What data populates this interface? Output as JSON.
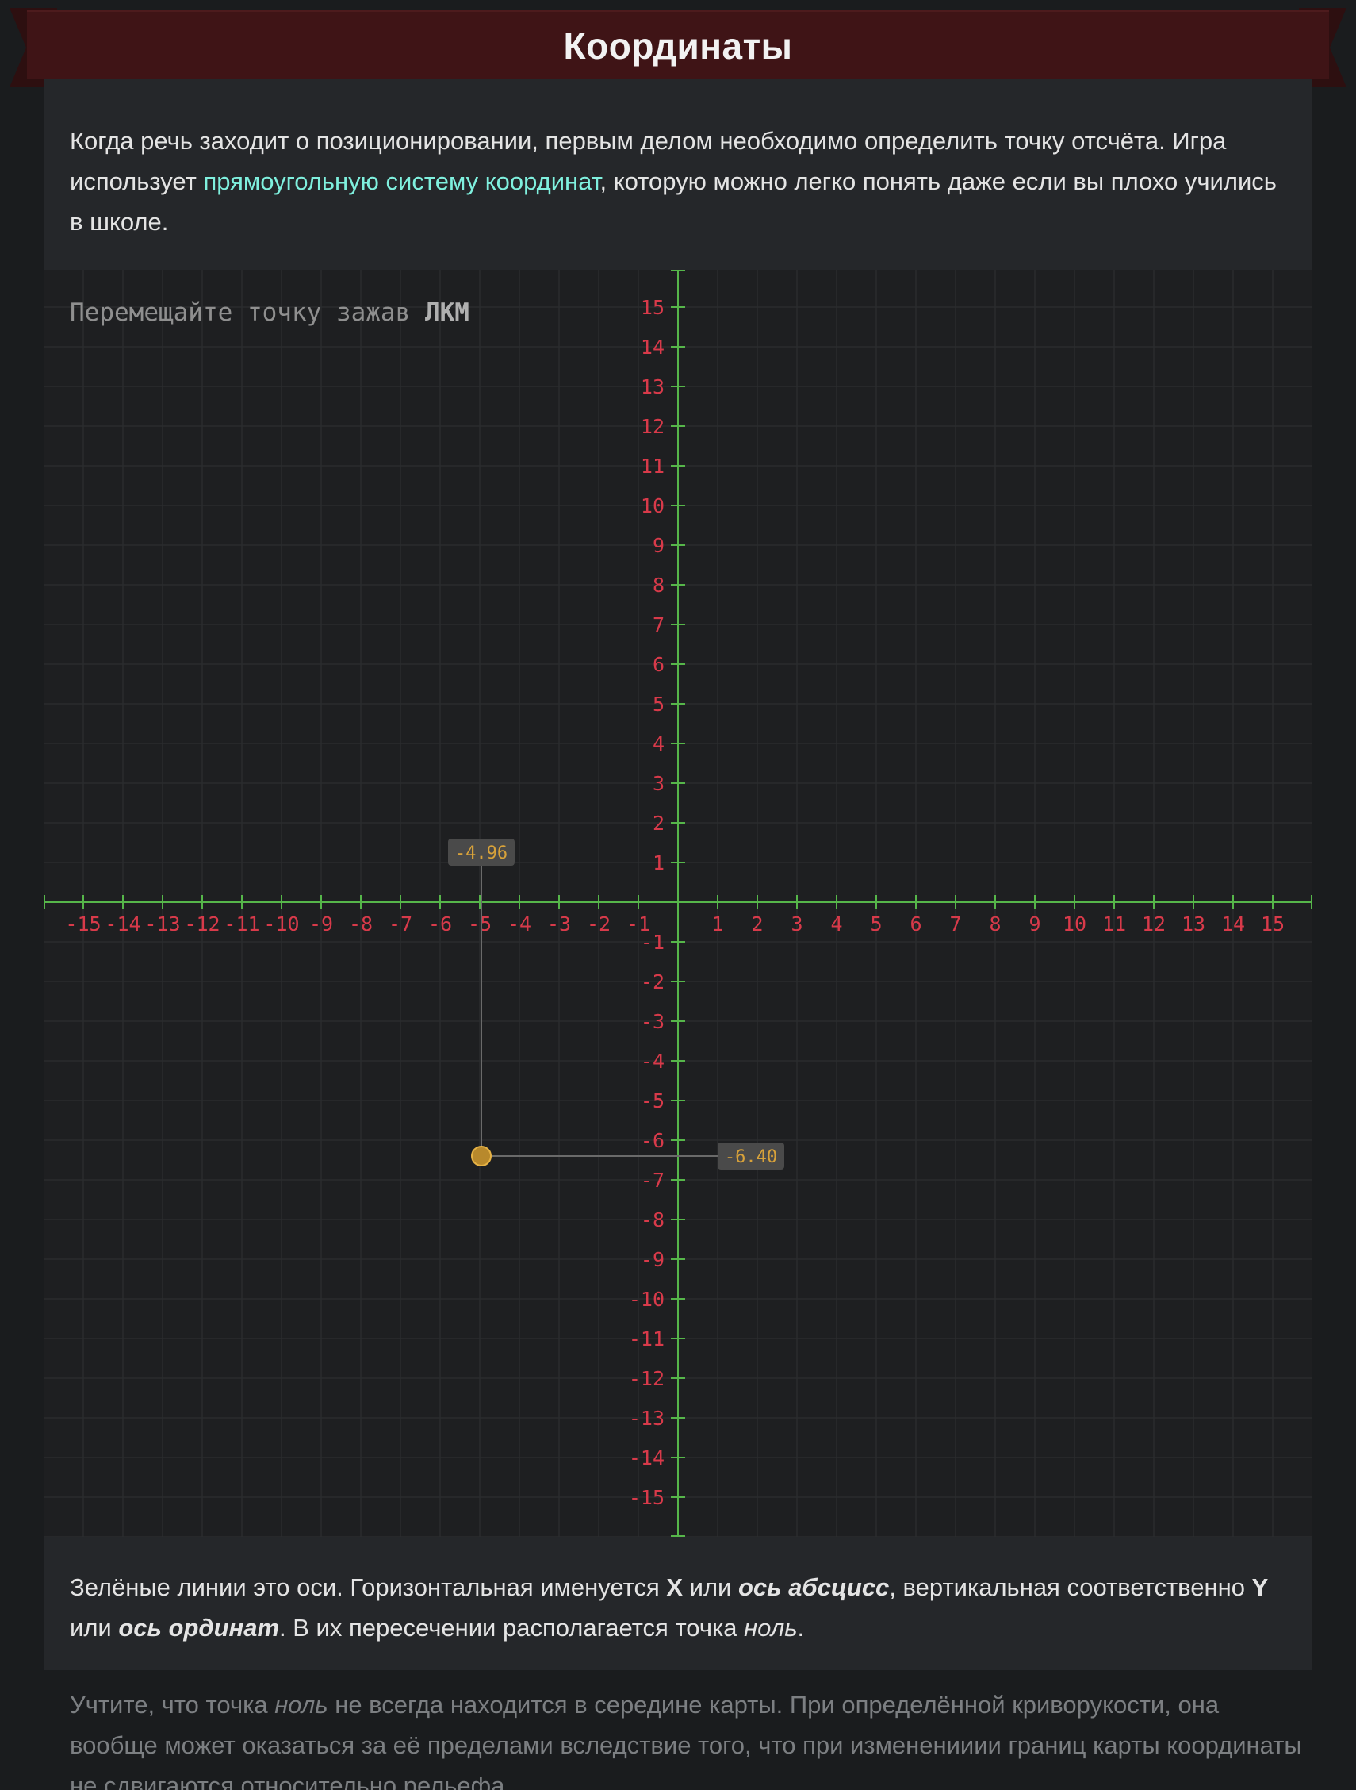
{
  "header": {
    "title": "Координаты"
  },
  "intro": {
    "text_before_link": "Когда речь заходит о позиционировании, первым делом необходимо определить точку отсчёта. Игра использует ",
    "link_text": "прямоугольную систему координат",
    "text_after_link": ", которую можно легко понять даже если вы плохо учились в школе."
  },
  "plot": {
    "hint_text": "Перемещайте точку зажав ",
    "hint_key": "ЛКМ",
    "x_ticks": [
      "-15",
      "-14",
      "-13",
      "-12",
      "-11",
      "-10",
      "-9",
      "-8",
      "-7",
      "-6",
      "-5",
      "-4",
      "-3",
      "-2",
      "-1",
      "1",
      "2",
      "3",
      "4",
      "5",
      "6",
      "7",
      "8",
      "9",
      "10",
      "11",
      "12",
      "13",
      "14",
      "15"
    ],
    "y_ticks": [
      "15",
      "14",
      "13",
      "12",
      "11",
      "10",
      "9",
      "8",
      "7",
      "6",
      "5",
      "4",
      "3",
      "2",
      "1",
      "-1",
      "-2",
      "-3",
      "-4",
      "-5",
      "-6",
      "-7",
      "-8",
      "-9",
      "-10",
      "-11",
      "-12",
      "-13",
      "-14",
      "-15"
    ],
    "x_range": [
      -15.5,
      16.0
    ],
    "y_range": [
      -16.0,
      16.0
    ],
    "point": {
      "x": -4.96,
      "y": -6.4
    },
    "point_x_label": "-4.96",
    "point_y_label": "-6.40",
    "colors": {
      "axis": "#56b64a",
      "tick_label": "#d83a4a",
      "grid": "#2a2c2e",
      "point_fill": "#b8892c",
      "point_stroke": "#e6b245",
      "value_text": "#d8a23a",
      "value_bg": "#4a4a4a",
      "guide": "#6a6a6a"
    }
  },
  "axes_explanation": {
    "t1": "Зелёные линии это оси. Горизонтальная именуется ",
    "x": "X",
    "t2": " или ",
    "abscissa": "ось абсцисс",
    "t3": ", вертикальная соответственно ",
    "y": "Y",
    "t4": " или ",
    "ordinate": "ось ординат",
    "t5": ". В их пересечении располагается точка ",
    "zero": "ноль",
    "t6": "."
  },
  "note": {
    "t1": "Учтите, что точка ",
    "zero": "ноль",
    "t2": " не всегда находится в середине карты. При определённой криворукости, она вообще может оказаться за её пределами вследствие того, что при измененииии границ карты координаты не сдвигаются относительно рельефа."
  }
}
